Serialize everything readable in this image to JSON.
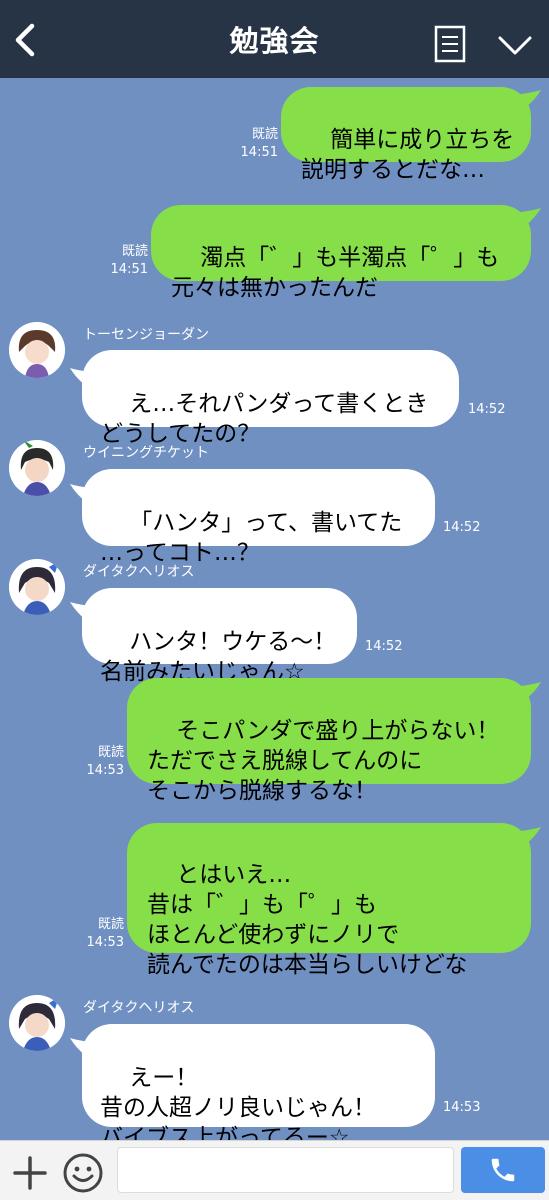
{
  "header": {
    "title": "勉強会"
  },
  "messages": [
    {
      "side": "me",
      "read_label": "既読",
      "time": "14:51",
      "text": "簡単に成り立ちを\n説明するとだな…"
    },
    {
      "side": "me",
      "read_label": "既読",
      "time": "14:51",
      "text": "濁点「゛」も半濁点「゜」も\n元々は無かったんだ"
    },
    {
      "side": "other",
      "sender": "トーセンジョーダン",
      "time": "14:52",
      "text": "え…それパンダって書くとき\nどうしてたの？"
    },
    {
      "side": "other",
      "sender": "ウイニングチケット",
      "time": "14:52",
      "text": "「ハンタ」って、書いてた\n…ってコト…？"
    },
    {
      "side": "other",
      "sender": "ダイタクヘリオス",
      "time": "14:52",
      "text": "ハンタ！ウケる〜！\n名前みたいじゃん☆"
    },
    {
      "side": "me",
      "read_label": "既読",
      "time": "14:53",
      "text": "そこパンダで盛り上がらない！\nただでさえ脱線してんのに\nそこから脱線するな！"
    },
    {
      "side": "me",
      "read_label": "既読",
      "time": "14:53",
      "text": "とはいえ…\n昔は「゛」も「゜」も\nほとんど使わずにノリで\n読んでたのは本当らしいけどな"
    },
    {
      "side": "other",
      "sender": "ダイタクヘリオス",
      "time": "14:53",
      "text": "えー！\n昔の人超ノリ良いじゃん！\nバイブス上がってるー☆"
    }
  ],
  "input": {
    "placeholder": ""
  },
  "colors": {
    "header": "#263445",
    "background": "#7190c2",
    "my_bubble": "#86de49",
    "other_bubble": "#ffffff",
    "call_button": "#4a8ee6"
  }
}
